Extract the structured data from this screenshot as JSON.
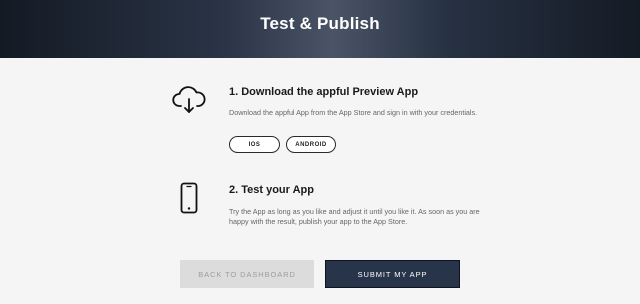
{
  "header": {
    "title": "Test & Publish"
  },
  "step1": {
    "icon": "cloud-download-icon",
    "title": "1. Download the appful Preview App",
    "text": "Download the appful App from the App Store and sign in with your credentials.",
    "ios_label": "IOS",
    "android_label": "ANDROID"
  },
  "step2": {
    "icon": "smartphone-icon",
    "title": "2. Test your App",
    "text": "Try the App as long as you like and adjust it until you like it. As soon as you are happy with the result, publish your app to the App Store."
  },
  "actions": {
    "back_label": "BACK TO DASHBOARD",
    "submit_label": "SUBMIT MY APP"
  },
  "colors": {
    "header_bg": "#1d2532",
    "submit_bg": "#27344a",
    "disabled_bg": "#dcdcdc",
    "page_bg": "#f5f5f5"
  }
}
